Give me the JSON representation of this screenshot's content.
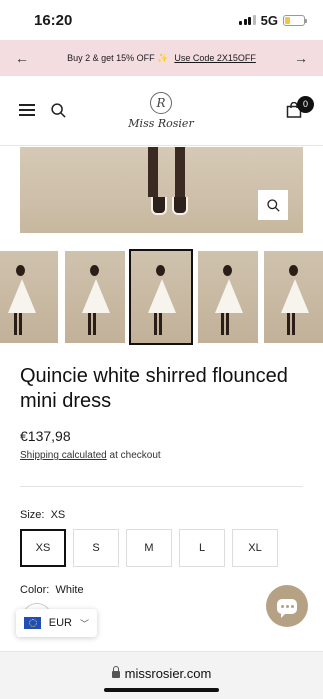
{
  "status_bar": {
    "time": "16:20",
    "network": "5G"
  },
  "promo": {
    "text": "Buy 2 & get 15% OFF ✨",
    "code_text": "Use Code 2X15OFF"
  },
  "brand": {
    "monogram": "R",
    "name": "Miss Rosier"
  },
  "cart": {
    "count": "0"
  },
  "product": {
    "title": "Quincie white shirred flounced mini dress",
    "price": "€137,98",
    "shipping_link": "Shipping calculated",
    "shipping_suffix": " at checkout"
  },
  "gallery": {
    "selected_index": 2,
    "thumb_count": 5
  },
  "size": {
    "label": "Size:",
    "selected": "XS",
    "options": [
      "XS",
      "S",
      "M",
      "L",
      "XL"
    ]
  },
  "color": {
    "label": "Color:",
    "selected": "White"
  },
  "currency": {
    "code": "EUR"
  },
  "browser": {
    "url": "missrosier.com"
  },
  "colors": {
    "promo_bg": "#f4dde0",
    "chat_button": "#b5a284"
  }
}
